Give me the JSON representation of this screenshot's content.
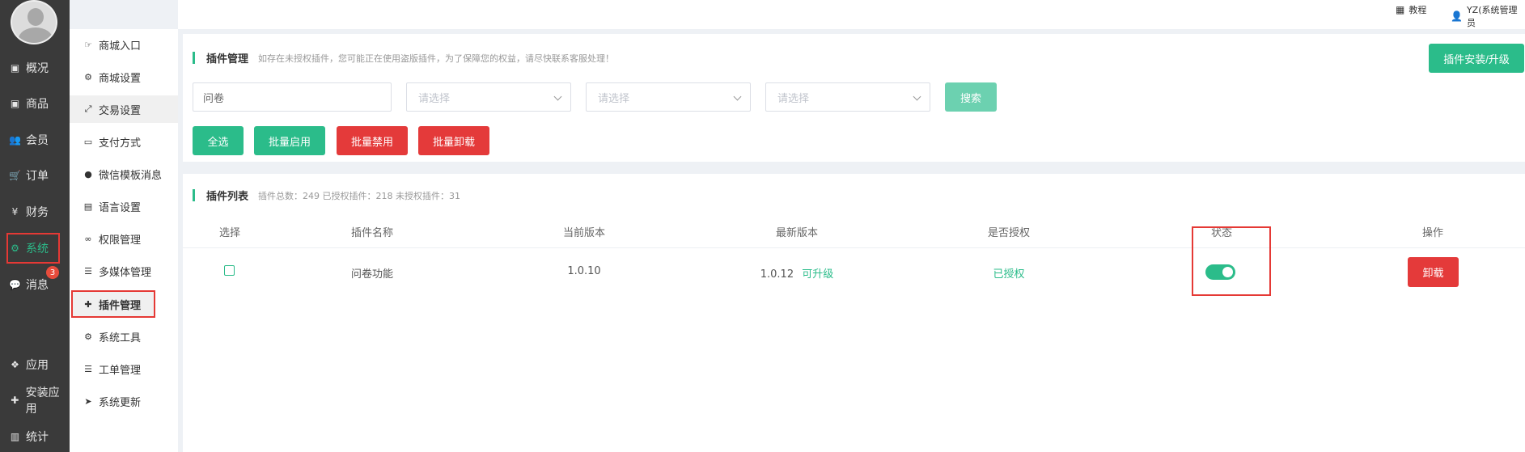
{
  "sidebar_main": {
    "items": [
      {
        "label": "概况",
        "icon": "calendar-icon"
      },
      {
        "label": "商品",
        "icon": "box-icon"
      },
      {
        "label": "会员",
        "icon": "users-icon"
      },
      {
        "label": "订单",
        "icon": "cart-icon"
      },
      {
        "label": "财务",
        "icon": "yen-icon"
      },
      {
        "label": "系统",
        "icon": "share-nodes-icon"
      },
      {
        "label": "消息",
        "icon": "chat-icon"
      },
      {
        "label": "应用",
        "icon": "cubes-icon"
      },
      {
        "label": "安装应用",
        "icon": "puzzle-icon"
      },
      {
        "label": "统计",
        "icon": "bar-chart-icon"
      }
    ],
    "message_badge": "3"
  },
  "sidebar_sub": {
    "items": [
      {
        "label": "商城入口",
        "icon": "hand-point-icon"
      },
      {
        "label": "商城设置",
        "icon": "gear-icon"
      },
      {
        "label": "交易设置",
        "icon": "exchange-icon"
      },
      {
        "label": "支付方式",
        "icon": "credit-card-icon"
      },
      {
        "label": "微信模板消息",
        "icon": "wechat-icon"
      },
      {
        "label": "语言设置",
        "icon": "language-icon"
      },
      {
        "label": "权限管理",
        "icon": "link-icon"
      },
      {
        "label": "多媒体管理",
        "icon": "list-icon"
      },
      {
        "label": "插件管理",
        "icon": "puzzle-icon"
      },
      {
        "label": "系统工具",
        "icon": "gear-icon"
      },
      {
        "label": "工单管理",
        "icon": "list-icon"
      },
      {
        "label": "系统更新",
        "icon": "send-icon"
      }
    ]
  },
  "topbar": {
    "tutorial": "教程",
    "user": "YZ(系统管理员"
  },
  "plugin_manage": {
    "title": "插件管理",
    "notice": "如存在未授权插件，您可能正在使用盗版插件，为了保障您的权益，请尽快联系客服处理！",
    "install_button": "插件安装/升级",
    "search_value": "问卷",
    "select_placeholder_1": "请选择",
    "select_placeholder_2": "请选择",
    "select_placeholder_3": "请选择",
    "search_button": "搜索",
    "select_all": "全选",
    "batch_enable": "批量启用",
    "batch_disable": "批量禁用",
    "batch_uninstall": "批量卸载"
  },
  "plugin_list": {
    "title": "插件列表",
    "summary": "插件总数：249 已授权插件：218 未授权插件：31",
    "columns": [
      "选择",
      "插件名称",
      "当前版本",
      "最新版本",
      "是否授权",
      "状态",
      "操作"
    ],
    "rows": [
      {
        "name": "问卷功能",
        "current_version": "1.0.10",
        "latest_version": "1.0.12",
        "upgrade_label": "可升级",
        "authorized": "已授权",
        "enabled": true,
        "action": "卸载"
      }
    ]
  },
  "colors": {
    "accent": "#2bbc8a",
    "danger": "#e43a3a",
    "sidebar_bg": "#3a3a3a"
  }
}
